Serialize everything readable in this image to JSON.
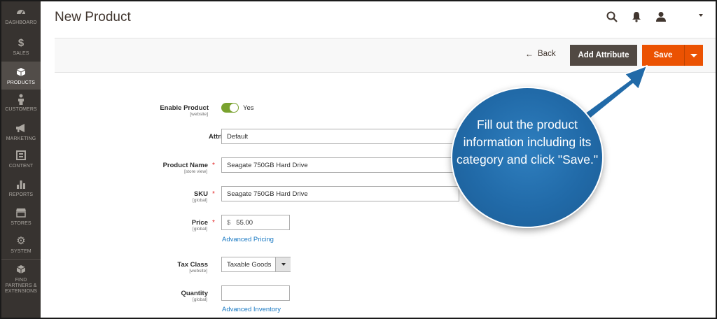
{
  "sidebar": {
    "items": [
      {
        "label": "DASHBOARD",
        "icon": "dashboard-icon",
        "active": false
      },
      {
        "label": "SALES",
        "icon": "dollar-icon",
        "active": false
      },
      {
        "label": "PRODUCTS",
        "icon": "cube-icon",
        "active": true
      },
      {
        "label": "CUSTOMERS",
        "icon": "person-icon",
        "active": false
      },
      {
        "label": "MARKETING",
        "icon": "megaphone-icon",
        "active": false
      },
      {
        "label": "CONTENT",
        "icon": "layout-icon",
        "active": false
      },
      {
        "label": "REPORTS",
        "icon": "bar-chart-icon",
        "active": false
      },
      {
        "label": "STORES",
        "icon": "store-icon",
        "active": false
      },
      {
        "label": "SYSTEM",
        "icon": "gear-icon",
        "active": false
      },
      {
        "label": "FIND PARTNERS & EXTENSIONS",
        "icon": "box-icon",
        "active": false
      }
    ],
    "dollar_glyph": "$"
  },
  "header": {
    "title": "New Product",
    "icons": [
      "search-icon",
      "bell-icon",
      "user-icon"
    ]
  },
  "toolbar": {
    "back_label": "Back",
    "back_arrow": "←",
    "add_attribute_label": "Add Attribute",
    "save_label": "Save"
  },
  "form": {
    "enable_product": {
      "label": "Enable Product",
      "scope": "[website]",
      "value": "Yes",
      "on": true
    },
    "attribute_set": {
      "label": "Attribute Set",
      "value": "Default"
    },
    "product_name": {
      "label": "Product Name",
      "scope": "[store view]",
      "value": "Seagate 750GB Hard Drive",
      "required": "*"
    },
    "sku": {
      "label": "SKU",
      "scope": "[global]",
      "value": "Seagate 750GB Hard Drive",
      "required": "*"
    },
    "price": {
      "label": "Price",
      "scope": "[global]",
      "currency": "$",
      "value": "55.00",
      "required": "*",
      "link": "Advanced Pricing"
    },
    "tax_class": {
      "label": "Tax Class",
      "scope": "[website]",
      "value": "Taxable Goods"
    },
    "quantity": {
      "label": "Quantity",
      "scope": "[global]",
      "value": "",
      "link": "Advanced Inventory"
    }
  },
  "callout": {
    "text": "Fill out the product information including its category and click \"Save.\""
  },
  "colors": {
    "sidebar_bg": "#373330",
    "save_orange": "#eb5202",
    "toggle_green": "#79a22e",
    "link_blue": "#1979c3",
    "callout_blue": "#216aa8"
  }
}
